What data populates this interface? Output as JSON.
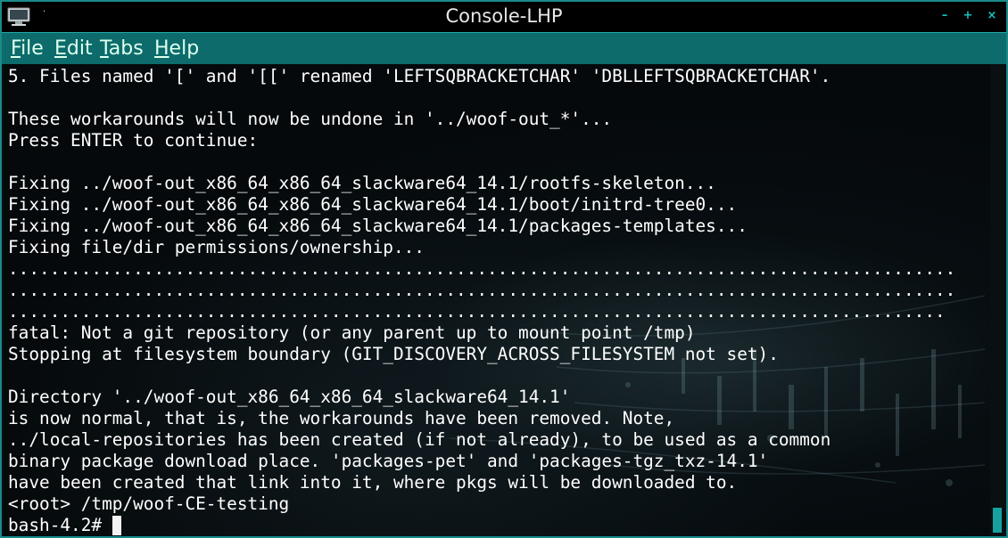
{
  "window": {
    "title": "Console-LHP",
    "title_dot": "·",
    "controls": {
      "minimize": "–",
      "maximize": "+",
      "close": "×"
    }
  },
  "menu": [
    {
      "name": "file",
      "underline": "F",
      "rest": "ile"
    },
    {
      "name": "edit",
      "underline": "E",
      "rest": "dit"
    },
    {
      "name": "tabs",
      "underline": "T",
      "rest": "abs"
    },
    {
      "name": "help",
      "underline": "H",
      "rest": "elp"
    }
  ],
  "terminal": {
    "lines": [
      "5. Files named '[' and '[[' renamed 'LEFTSQBRACKETCHAR' 'DBLLEFTSQBRACKETCHAR'.",
      "",
      "These workarounds will now be undone in '../woof-out_*'...",
      "Press ENTER to continue:",
      "",
      "Fixing ../woof-out_x86_64_x86_64_slackware64_14.1/rootfs-skeleton...",
      "Fixing ../woof-out_x86_64_x86_64_slackware64_14.1/boot/initrd-tree0...",
      "Fixing ../woof-out_x86_64_x86_64_slackware64_14.1/packages-templates...",
      "Fixing file/dir permissions/ownership...",
      "...........................................................................................",
      "...........................................................................................",
      "..........................................................................................",
      "fatal: Not a git repository (or any parent up to mount point /tmp)",
      "Stopping at filesystem boundary (GIT_DISCOVERY_ACROSS_FILESYSTEM not set).",
      "",
      "Directory '../woof-out_x86_64_x86_64_slackware64_14.1'",
      "is now normal, that is, the workarounds have been removed. Note,",
      "../local-repositories has been created (if not already), to be used as a common",
      "binary package download place. 'packages-pet' and 'packages-tgz_txz-14.1'",
      "have been created that link into it, where pkgs will be downloaded to.",
      "<root> /tmp/woof-CE-testing"
    ],
    "prompt": "bash-4.2# "
  },
  "colors": {
    "accent": "#16c0c0",
    "menubar": "#0d6b6b",
    "terminal_bg": "#05090b",
    "text": "#ffffff"
  },
  "icons": {
    "app": "monitor-icon"
  }
}
